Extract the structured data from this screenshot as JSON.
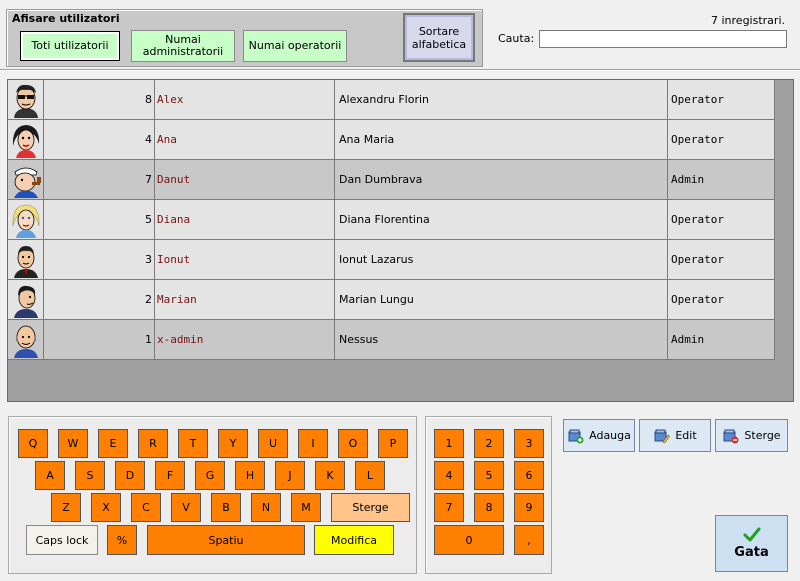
{
  "filter": {
    "title": "Afisare utilizatori",
    "all_label": "Toti utilizatorii",
    "admins_label": "Numai administratorii",
    "operators_label": "Numai operatorii",
    "sort_label": "Sortare alfabetica"
  },
  "search": {
    "count_label": "7 inregistrari.",
    "label": "Cauta:",
    "value": ""
  },
  "users": [
    {
      "id": "8",
      "username": "Alex",
      "name": "Alexandru Florin",
      "role": "Operator",
      "avatar": "man-glasses-icon"
    },
    {
      "id": "4",
      "username": "Ana",
      "name": "Ana Maria",
      "role": "Operator",
      "avatar": "woman-dark-hair-icon"
    },
    {
      "id": "7",
      "username": "Danut",
      "name": "Dan Dumbrava",
      "role": "Admin",
      "avatar": "sailor-pipe-icon"
    },
    {
      "id": "5",
      "username": "Diana",
      "name": "Diana Florentina",
      "role": "Operator",
      "avatar": "woman-blonde-icon"
    },
    {
      "id": "3",
      "username": "Ionut",
      "name": "Ionut Lazarus",
      "role": "Operator",
      "avatar": "man-suit-icon"
    },
    {
      "id": "2",
      "username": "Marian",
      "name": "Marian Lungu",
      "role": "Operator",
      "avatar": "man-side-icon"
    },
    {
      "id": "1",
      "username": "x-admin",
      "name": "Nessus",
      "role": "Admin",
      "avatar": "bald-man-icon"
    }
  ],
  "keyboard": {
    "row1": [
      "Q",
      "W",
      "E",
      "R",
      "T",
      "Y",
      "U",
      "I",
      "O",
      "P"
    ],
    "row2": [
      "A",
      "S",
      "D",
      "F",
      "G",
      "H",
      "J",
      "K",
      "L"
    ],
    "row3": [
      "Z",
      "X",
      "C",
      "V",
      "B",
      "N",
      "M"
    ],
    "delete_label": "Sterge",
    "caps_label": "Caps lock",
    "percent_label": "%",
    "space_label": "Spatiu",
    "modify_label": "Modifica"
  },
  "numpad": {
    "keys": [
      "1",
      "2",
      "3",
      "4",
      "5",
      "6",
      "7",
      "8",
      "9"
    ],
    "zero": "0",
    "comma": ","
  },
  "actions": {
    "add_label": "Adauga",
    "edit_label": "Edit",
    "delete_label": "Sterge",
    "done_label": "Gata"
  },
  "colors": {
    "key_orange": "#ff8000",
    "filter_green": "#c8ffc8",
    "username_text": "#7a1010"
  }
}
